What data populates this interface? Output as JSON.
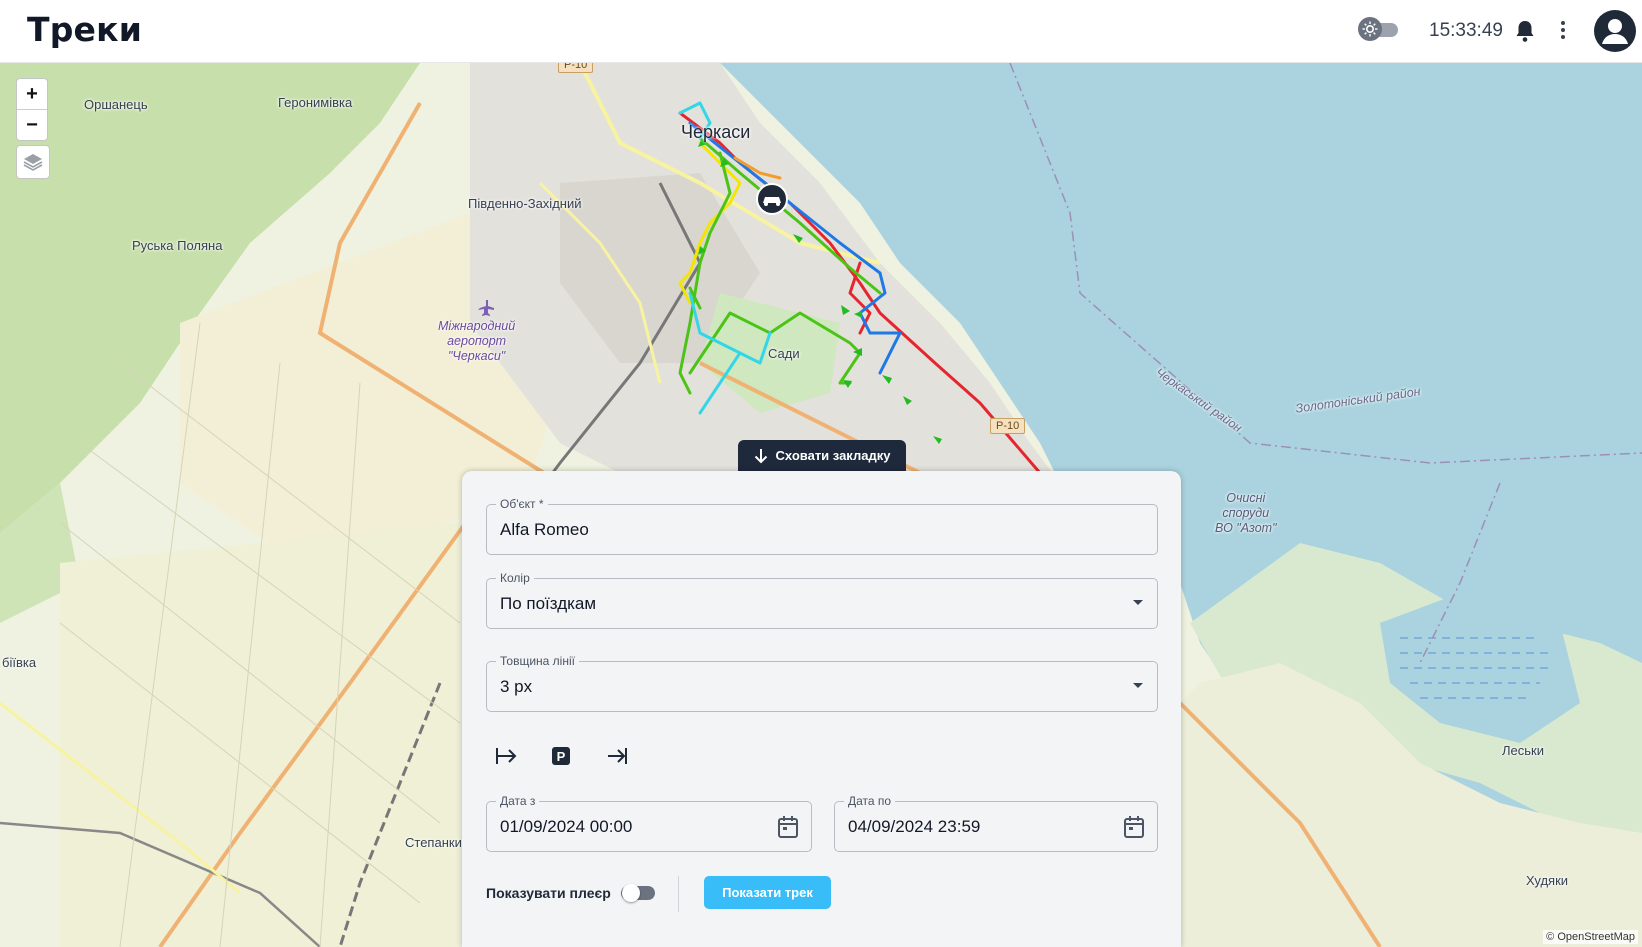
{
  "header": {
    "title": "Треки",
    "time": "15:33:49"
  },
  "map": {
    "labels": {
      "orshanets": "Оршанець",
      "heronymivka": "Геронимівка",
      "cherkasy": "Черкаси",
      "pivdenno_zakhidnyi": "Південно-Західний",
      "ruska_poliana": "Руська Поляна",
      "airport_line1": "Міжнародний",
      "airport_line2": "аеропорт",
      "airport_line3": "\"Черкаси\"",
      "sady": "Сади",
      "zolotonoskyi": "Золотоніський район",
      "cherkaskyi": "Черкаський район",
      "ochysni_line1": "Очисні",
      "ochysni_line2": "споруди",
      "ochysni_line3": "ВО \"Азот\"",
      "lesky": "Леськи",
      "khudiaky": "Худяки",
      "stepanky": "Степанки",
      "biivka": "біївка",
      "road_p10_top": "Р-10",
      "road_p10_bottom": "Р-10"
    },
    "zoom_in": "+",
    "zoom_out": "−",
    "attribution": "© OpenStreetMap"
  },
  "panel": {
    "hide_tab_label": "Сховати закладку",
    "object": {
      "label": "Об'єкт *",
      "value": "Alfa Romeo"
    },
    "color": {
      "label": "Колір",
      "value": "По поїздкам"
    },
    "line_width": {
      "label": "Товщина лінії",
      "value": "3 px"
    },
    "date_from": {
      "label": "Дата з",
      "value": "01/09/2024 00:00"
    },
    "date_to": {
      "label": "Дата по",
      "value": "04/09/2024 23:59"
    },
    "player_label": "Показувати плеєр",
    "player_enabled": false,
    "show_track_button": "Показати трек",
    "parking_icon_text": "P"
  },
  "colors": {
    "water": "#aad3df",
    "track_red": "#e5262f",
    "track_green": "#4cc417",
    "track_blue": "#1e78e6",
    "track_yellow": "#f2e600",
    "track_cyan": "#33d6e6",
    "track_orange": "#f39c2b",
    "button_blue": "#38bdf8",
    "tab_dark": "#1e293b"
  }
}
